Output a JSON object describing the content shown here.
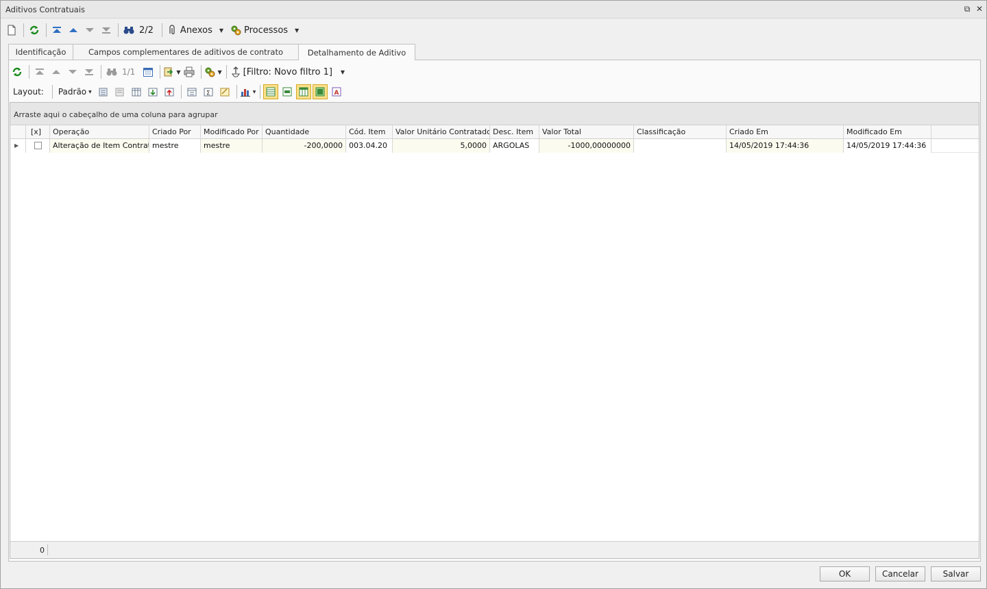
{
  "window": {
    "title": "Aditivos Contratuais",
    "restore_icon": "restore-icon",
    "close_icon": "close-icon"
  },
  "main_toolbar": {
    "record_counter": "2/2",
    "attachments_label": "Anexos",
    "processes_label": "Processos"
  },
  "tabs": [
    {
      "label": "Identificação"
    },
    {
      "label": "Campos complementares de aditivos de contrato"
    },
    {
      "label": "Detalhamento de Aditivo"
    }
  ],
  "active_tab": "Detalhamento de Aditivo",
  "grid_toolbar": {
    "record_counter": "1/1",
    "filter_label": "[Filtro: Novo filtro 1]"
  },
  "layout_toolbar": {
    "layout_label": "Layout:",
    "layout_value": "Padrão"
  },
  "group_panel": {
    "hint": "Arraste aqui o cabeçalho de uma coluna para agrupar"
  },
  "grid": {
    "columns": [
      "[x]",
      "Operação",
      "Criado Por",
      "Modificado Por",
      "Quantidade",
      "Cód. Item",
      "Valor Unitário Contratado",
      "Desc. Item",
      "Valor Total",
      "Classificação",
      "Criado Em",
      "Modificado Em"
    ],
    "rows": [
      {
        "selected": false,
        "operacao": "Alteração de Item Contrat...",
        "criado_por": "mestre",
        "modificado_por": "mestre",
        "quantidade": "-200,0000",
        "cod_item": "003.04.20",
        "valor_unitario": "5,0000",
        "desc_item": "ARGOLAS",
        "valor_total": "-1000,00000000",
        "classificacao": "",
        "criado_em": "14/05/2019 17:44:36",
        "modificado_em": "14/05/2019 17:44:36"
      }
    ],
    "footer_count": "0"
  },
  "buttons": {
    "ok": "OK",
    "cancel": "Cancelar",
    "save": "Salvar"
  }
}
